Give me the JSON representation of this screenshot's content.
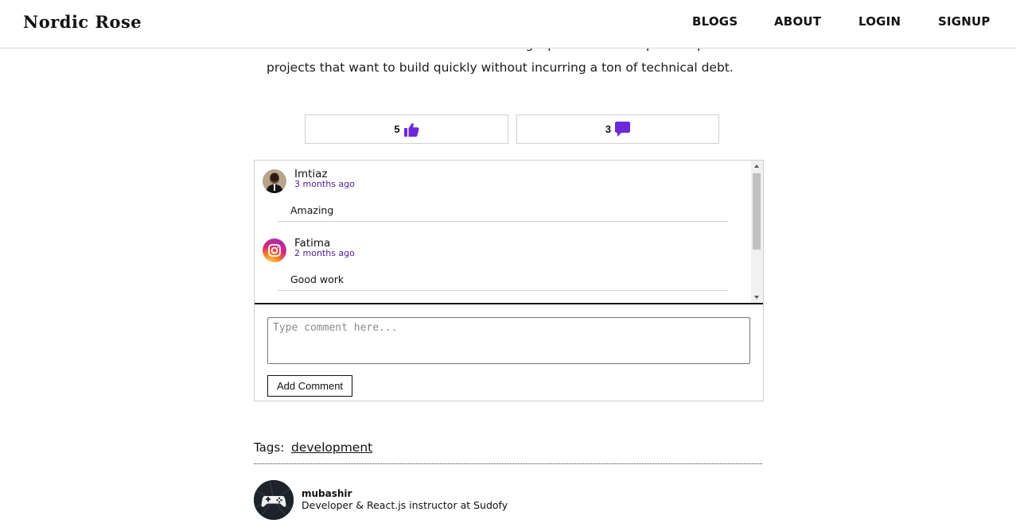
{
  "header": {
    "brand": "Nordic Rose",
    "nav": [
      "BLOGS",
      "ABOUT",
      "LOGIN",
      "SIGNUP"
    ]
  },
  "article": {
    "text": "Database. This makes Fauna an amazing option for startups and personal projects that want to build quickly without incurring a ton of technical debt."
  },
  "reactions": {
    "likes": "5",
    "comments": "3",
    "accent_color": "#6d28d9"
  },
  "comments": [
    {
      "name": "Imtiaz",
      "time": "3 months ago",
      "body": "Amazing",
      "avatar_icon": "user-photo-avatar"
    },
    {
      "name": "Fatima",
      "time": "2 months ago",
      "body": "Good work",
      "avatar_icon": "instagram-logo-icon"
    }
  ],
  "comment_form": {
    "placeholder": "Type comment here...",
    "submit_label": "Add Comment"
  },
  "tags": {
    "label": "Tags:",
    "items": [
      "development"
    ]
  },
  "author": {
    "name": "mubashir",
    "bio": "Developer & React.js instructor at Sudofy",
    "avatar_icon": "gamepad-icon"
  }
}
